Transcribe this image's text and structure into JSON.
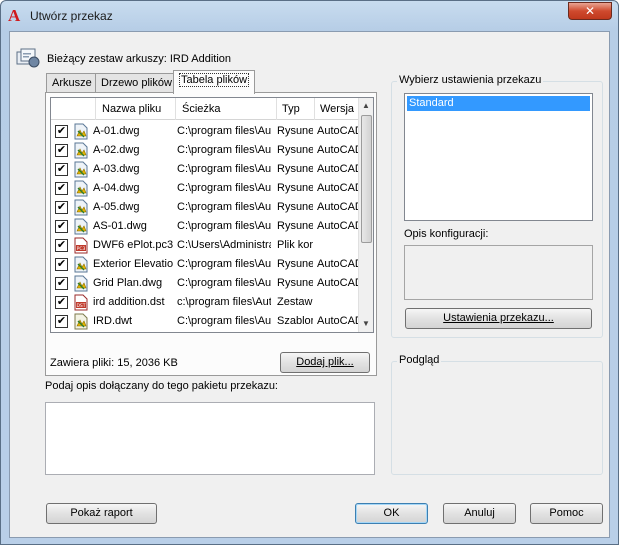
{
  "window": {
    "title": "Utwórz przekaz",
    "close_glyph": "✕",
    "app_icon": "autocad-logo-icon"
  },
  "current_sheet_set": "Bieżący zestaw arkuszy: IRD Addition",
  "tabs": [
    {
      "label": "Arkusze",
      "active": false
    },
    {
      "label": "Drzewo plików",
      "active": false
    },
    {
      "label": "Tabela plików",
      "active": true
    }
  ],
  "file_table": {
    "columns": [
      "Nazwa pliku",
      "Ścieżka",
      "Typ",
      "Wersja"
    ],
    "rows": [
      {
        "checked": true,
        "icon": "dwg-file-icon",
        "name": "A-01.dwg",
        "path": "C:\\program files\\Aut",
        "type": "Rysune",
        "version": "AutoCAD"
      },
      {
        "checked": true,
        "icon": "dwg-file-icon",
        "name": "A-02.dwg",
        "path": "C:\\program files\\Aut",
        "type": "Rysune",
        "version": "AutoCAD"
      },
      {
        "checked": true,
        "icon": "dwg-file-icon",
        "name": "A-03.dwg",
        "path": "C:\\program files\\Aut",
        "type": "Rysune",
        "version": "AutoCAD"
      },
      {
        "checked": true,
        "icon": "dwg-file-icon",
        "name": "A-04.dwg",
        "path": "C:\\program files\\Aut",
        "type": "Rysune",
        "version": "AutoCAD"
      },
      {
        "checked": true,
        "icon": "dwg-file-icon",
        "name": "A-05.dwg",
        "path": "C:\\program files\\Aut",
        "type": "Rysune",
        "version": "AutoCAD"
      },
      {
        "checked": true,
        "icon": "dwg-file-icon",
        "name": "AS-01.dwg",
        "path": "C:\\program files\\Aut",
        "type": "Rysune",
        "version": "AutoCAD"
      },
      {
        "checked": true,
        "icon": "pc3-file-icon",
        "name": "DWF6 ePlot.pc3",
        "path": "C:\\Users\\Administra",
        "type": "Plik kor",
        "version": ""
      },
      {
        "checked": true,
        "icon": "dwg-file-icon",
        "name": "Exterior Elevatio",
        "path": "C:\\program files\\Aut",
        "type": "Rysune",
        "version": "AutoCAD"
      },
      {
        "checked": true,
        "icon": "dwg-file-icon",
        "name": "Grid Plan.dwg",
        "path": "C:\\program files\\Aut",
        "type": "Rysune",
        "version": "AutoCAD"
      },
      {
        "checked": true,
        "icon": "dst-file-icon",
        "name": "ird addition.dst",
        "path": "c:\\program files\\Auto",
        "type": "Zestaw",
        "version": ""
      },
      {
        "checked": true,
        "icon": "dwt-file-icon",
        "name": "IRD.dwt",
        "path": "C:\\program files\\Aut",
        "type": "Szablor",
        "version": "AutoCAD"
      }
    ]
  },
  "files_summary": "Zawiera pliki: 15, 2036 KB",
  "add_file_button": "Dodaj plik...",
  "description": {
    "label": "Podaj opis dołączany do tego pakietu przekazu:",
    "value": ""
  },
  "transmittal_settings": {
    "title": "Wybierz ustawienia przekazu",
    "options": [
      "Standard"
    ],
    "selected": "Standard",
    "config_label": "Opis konfiguracji:",
    "config_value": "",
    "settings_button": "Ustawienia przekazu..."
  },
  "preview": {
    "title": "Podgląd"
  },
  "footer": {
    "report_button": "Pokaż raport",
    "ok_button": "OK",
    "cancel_button": "Anuluj",
    "help_button": "Pomoc"
  },
  "colors": {
    "selection": "#3399ff",
    "title_bar": "#c8dcef",
    "close_button": "#cf4a2e"
  }
}
